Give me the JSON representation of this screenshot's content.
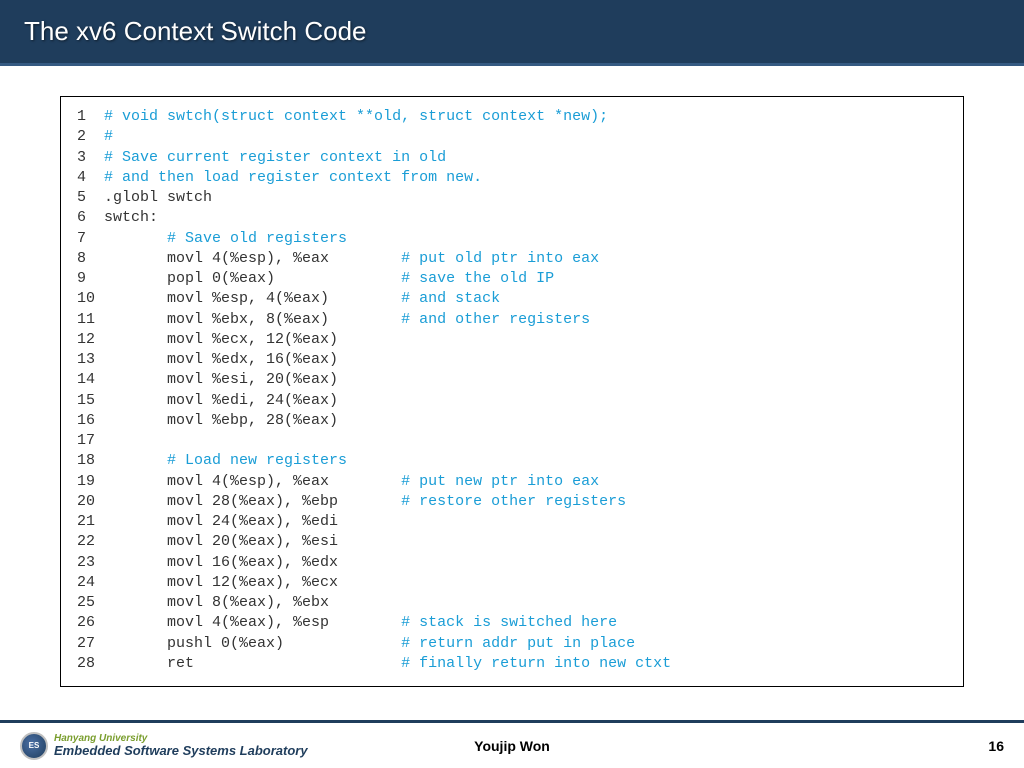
{
  "title": "The xv6 Context Switch Code",
  "code": [
    {
      "n": "1",
      "indent": "",
      "code": "",
      "comment": "# void swtch(struct context **old, struct context *new);"
    },
    {
      "n": "2",
      "indent": "",
      "code": "",
      "comment": "#"
    },
    {
      "n": "3",
      "indent": "",
      "code": "",
      "comment": "# Save current register context in old"
    },
    {
      "n": "4",
      "indent": "",
      "code": "",
      "comment": "# and then load register context from new."
    },
    {
      "n": "5",
      "indent": "",
      "code": ".globl swtch",
      "comment": ""
    },
    {
      "n": "6",
      "indent": "",
      "code": "swtch:",
      "comment": ""
    },
    {
      "n": "7",
      "indent": "       ",
      "code": "",
      "comment": "# Save old registers"
    },
    {
      "n": "8",
      "indent": "       ",
      "code": "movl 4(%esp), %eax",
      "pad": "        ",
      "comment": "# put old ptr into eax"
    },
    {
      "n": "9",
      "indent": "       ",
      "code": "popl 0(%eax)",
      "pad": "              ",
      "comment": "# save the old IP"
    },
    {
      "n": "10",
      "indent": "       ",
      "code": "movl %esp, 4(%eax)",
      "pad": "        ",
      "comment": "# and stack"
    },
    {
      "n": "11",
      "indent": "       ",
      "code": "movl %ebx, 8(%eax)",
      "pad": "        ",
      "comment": "# and other registers"
    },
    {
      "n": "12",
      "indent": "       ",
      "code": "movl %ecx, 12(%eax)",
      "comment": ""
    },
    {
      "n": "13",
      "indent": "       ",
      "code": "movl %edx, 16(%eax)",
      "comment": ""
    },
    {
      "n": "14",
      "indent": "       ",
      "code": "movl %esi, 20(%eax)",
      "comment": ""
    },
    {
      "n": "15",
      "indent": "       ",
      "code": "movl %edi, 24(%eax)",
      "comment": ""
    },
    {
      "n": "16",
      "indent": "       ",
      "code": "movl %ebp, 28(%eax)",
      "comment": ""
    },
    {
      "n": "17",
      "indent": "",
      "code": "",
      "comment": ""
    },
    {
      "n": "18",
      "indent": "       ",
      "code": "",
      "comment": "# Load new registers"
    },
    {
      "n": "19",
      "indent": "       ",
      "code": "movl 4(%esp), %eax",
      "pad": "        ",
      "comment": "# put new ptr into eax"
    },
    {
      "n": "20",
      "indent": "       ",
      "code": "movl 28(%eax), %ebp",
      "pad": "       ",
      "comment": "# restore other registers"
    },
    {
      "n": "21",
      "indent": "       ",
      "code": "movl 24(%eax), %edi",
      "comment": ""
    },
    {
      "n": "22",
      "indent": "       ",
      "code": "movl 20(%eax), %esi",
      "comment": ""
    },
    {
      "n": "23",
      "indent": "       ",
      "code": "movl 16(%eax), %edx",
      "comment": ""
    },
    {
      "n": "24",
      "indent": "       ",
      "code": "movl 12(%eax), %ecx",
      "comment": ""
    },
    {
      "n": "25",
      "indent": "       ",
      "code": "movl 8(%eax), %ebx",
      "comment": ""
    },
    {
      "n": "26",
      "indent": "       ",
      "code": "movl 4(%eax), %esp",
      "pad": "        ",
      "comment": "# stack is switched here"
    },
    {
      "n": "27",
      "indent": "       ",
      "code": "pushl 0(%eax)",
      "pad": "             ",
      "comment": "# return addr put in place"
    },
    {
      "n": "28",
      "indent": "       ",
      "code": "ret",
      "pad": "                       ",
      "comment": "# finally return into new ctxt"
    }
  ],
  "footer": {
    "logo_top": "Hanyang University",
    "logo_bottom": "Embedded Software Systems Laboratory",
    "author": "Youjip Won",
    "page": "16"
  }
}
